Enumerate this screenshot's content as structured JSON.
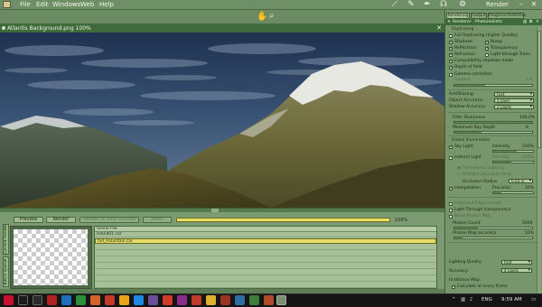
{
  "menubar": {
    "items": [
      "File",
      "Edit",
      "Windows",
      "Web",
      "Help"
    ],
    "render_label": "Render",
    "tool_icons": [
      "feather-icon",
      "brush-icon",
      "pen-icon",
      "figure-icon",
      "gear-icon"
    ]
  },
  "toolbar": {
    "hand_icon": "hand-icon",
    "zoom_icon": "zoom-icon"
  },
  "document": {
    "title": "Atlantis Background.png 100%"
  },
  "render_controls": {
    "preview_label": "Preview",
    "render_label": "Render",
    "render_disabled_label": "Render to New Window",
    "abort_label": "Abort",
    "progress": 1.0,
    "progress_text": "100%",
    "vertical_tabs": [
      "Current Render",
      "Batch Queue"
    ],
    "file_list": {
      "header": "Scene File",
      "rows": [
        "island01.car",
        "full_mountain.car"
      ],
      "selected_index": 1
    }
  },
  "right_panel": {
    "tabs": [
      "Rendering",
      "Output",
      "Progress/Statistics"
    ],
    "subtabs": [
      "Renderer",
      "Photorealistic"
    ],
    "raytracing": {
      "heading": "Raytracing",
      "full_raytracing": "Full Raytracing (higher Quality)",
      "shadows": "Shadows",
      "bump": "Bump",
      "reflections": "Reflections",
      "transparency": "Transparency",
      "refraction": "Refraction",
      "light_through_trans": "Light through Trans.",
      "compat_shadows": "Compatibility shadows mode",
      "depth_of_field": "Depth of field",
      "gamma_correction": "Gamma correction",
      "gamma_label": "Gamma",
      "gamma_value": "1.8"
    },
    "antialiasing": {
      "label": "AntiAliasing:",
      "value": "Fast"
    },
    "object_accuracy": {
      "label": "Object Accuracy:",
      "value": "1 pixel"
    },
    "shadow_accuracy": {
      "label": "Shadow Accuracy:",
      "value": "2 pixels"
    },
    "filter_sharpness": {
      "label": "Filter Sharpness",
      "value": "100.0%"
    },
    "max_ray_depth": {
      "label": "Maximum Ray Depth",
      "value": "8"
    },
    "global_illumination": {
      "heading": "Global Illumination",
      "sky_light": "Sky Light",
      "intensity_label": "Intensity",
      "sky_intensity": "200%",
      "indirect_light": "Indirect Light",
      "indirect_intensity": "100%",
      "full_indirect": "Full Indirect Lighting",
      "ambient_occlusion": "Ambient Occlusion Only",
      "occlusion_radius_label": "Occlusion Radius",
      "occlusion_radius": "0.03 in",
      "interpolation": "Interpolation:",
      "precision_label": "Precision",
      "precision_value": "20%",
      "improved_edges": "Improved Edges (slow)",
      "light_through_transparency": "Light Through transparency",
      "show_photon_map": "Show Photon Map",
      "photon_count_label": "Photon Count",
      "photon_count": "5000",
      "photon_map_accuracy_label": "Photon Map accuracy",
      "photon_map_accuracy": "10%",
      "lighting_quality_label": "Lighting Quality:",
      "lighting_quality": "Fast",
      "accuracy_label": "Accuracy:",
      "accuracy": "4 pixels",
      "irradiance_map": "Irradiance Map:",
      "calc_every_frame": "Calculate at every frame"
    }
  },
  "taskbar": {
    "language": "ENG",
    "time": "9:59 AM"
  },
  "colors": {
    "panel_green": "#78966c",
    "title_green": "#3d6b3a",
    "progress_yellow": "#e0d85a",
    "selected_row": "#e6dd66"
  }
}
